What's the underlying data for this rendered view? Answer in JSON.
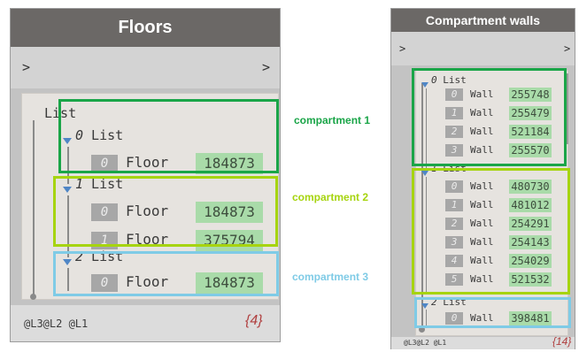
{
  "floors_node": {
    "title": "Floors",
    "in_port": ">",
    "out_port": ">",
    "root_label": "List",
    "groups": [
      {
        "label": "0 List",
        "items": [
          {
            "index": "0",
            "type": "Floor",
            "value": "184873"
          }
        ]
      },
      {
        "label": "1 List",
        "items": [
          {
            "index": "0",
            "type": "Floor",
            "value": "184873"
          },
          {
            "index": "1",
            "type": "Floor",
            "value": "375794"
          }
        ]
      },
      {
        "label": "2 List",
        "items": [
          {
            "index": "0",
            "type": "Floor",
            "value": "184873"
          }
        ]
      }
    ],
    "levels": "@L3@L2 @L1",
    "count": "{4}"
  },
  "walls_node": {
    "title": "Compartment walls",
    "in_port": ">",
    "out_port": ">",
    "groups": [
      {
        "label": "0 List",
        "items": [
          {
            "index": "0",
            "type": "Wall",
            "value": "255748"
          },
          {
            "index": "1",
            "type": "Wall",
            "value": "255479"
          },
          {
            "index": "2",
            "type": "Wall",
            "value": "521184"
          },
          {
            "index": "3",
            "type": "Wall",
            "value": "255570"
          }
        ]
      },
      {
        "label": "1 List",
        "items": [
          {
            "index": "0",
            "type": "Wall",
            "value": "480730"
          },
          {
            "index": "1",
            "type": "Wall",
            "value": "481012"
          },
          {
            "index": "2",
            "type": "Wall",
            "value": "254291"
          },
          {
            "index": "3",
            "type": "Wall",
            "value": "254143"
          },
          {
            "index": "4",
            "type": "Wall",
            "value": "254029"
          },
          {
            "index": "5",
            "type": "Wall",
            "value": "521532"
          }
        ]
      },
      {
        "label": "2 List",
        "items": [
          {
            "index": "0",
            "type": "Wall",
            "value": "398481"
          }
        ]
      }
    ],
    "levels": "@L3@L2 @L1",
    "count": "{14}"
  },
  "annotations": [
    {
      "text": "compartment 1",
      "color": "#1aa548"
    },
    {
      "text": "compartment 2",
      "color": "#a6d40f"
    },
    {
      "text": "compartment 3",
      "color": "#7fcbe6"
    }
  ]
}
